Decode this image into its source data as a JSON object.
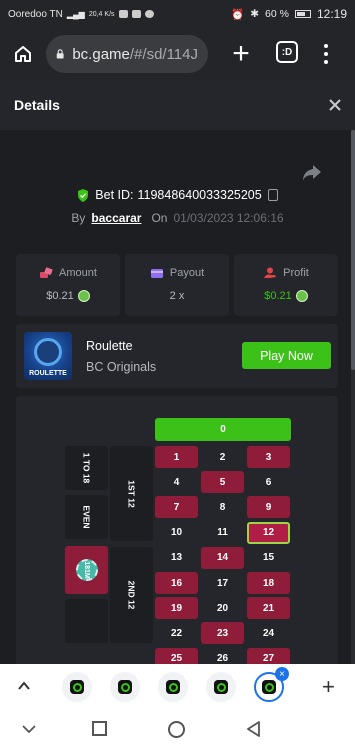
{
  "status_bar": {
    "carrier": "Ooredoo TN",
    "speed": "20,4 K/s",
    "battery": "60 %",
    "time": "12:19"
  },
  "browser": {
    "url_main": "bc.game",
    "url_path": "/#/sd/114J",
    "tabs_count_label": ":D"
  },
  "details": {
    "title": "Details",
    "bet_id_label": "Bet ID:",
    "bet_id": "119848640033325205",
    "by_label": "By",
    "user": "baccarar",
    "on_label": "On",
    "timestamp": "01/03/2023 12:06:16"
  },
  "stats": [
    {
      "label": "Amount",
      "value": "$0.21",
      "icon": "bet-chips-icon",
      "color": "#d94a6b"
    },
    {
      "label": "Payout",
      "value": "2 x",
      "icon": "payout-card-icon",
      "color": "#8f6cf0"
    },
    {
      "label": "Profit",
      "value": "$0.21",
      "icon": "profit-hand-icon",
      "color": "#e04545"
    }
  ],
  "game": {
    "name": "Roulette",
    "provider": "BC Originals",
    "thumb_label": "ROULETTE",
    "play_label": "Play Now"
  },
  "board": {
    "zero": "0",
    "outside_left": [
      "1 TO 18",
      "EVEN"
    ],
    "dozens": [
      "1ST 12",
      "2ND 12"
    ],
    "chip_label": "181M",
    "rows": [
      [
        "1",
        "2",
        "3"
      ],
      [
        "4",
        "5",
        "6"
      ],
      [
        "7",
        "8",
        "9"
      ],
      [
        "10",
        "11",
        "12"
      ],
      [
        "13",
        "14",
        "15"
      ],
      [
        "16",
        "17",
        "18"
      ],
      [
        "19",
        "20",
        "21"
      ],
      [
        "22",
        "23",
        "24"
      ],
      [
        "25",
        "26",
        "27"
      ]
    ],
    "red_numbers": [
      "1",
      "3",
      "5",
      "7",
      "9",
      "12",
      "14",
      "16",
      "18",
      "19",
      "21",
      "23",
      "25",
      "27"
    ],
    "selected_number": "12"
  },
  "colors": {
    "accent_green": "#3bc117",
    "roulette_red": "#8f1d3a",
    "panel": "#24262b",
    "background": "#1c1e22"
  }
}
